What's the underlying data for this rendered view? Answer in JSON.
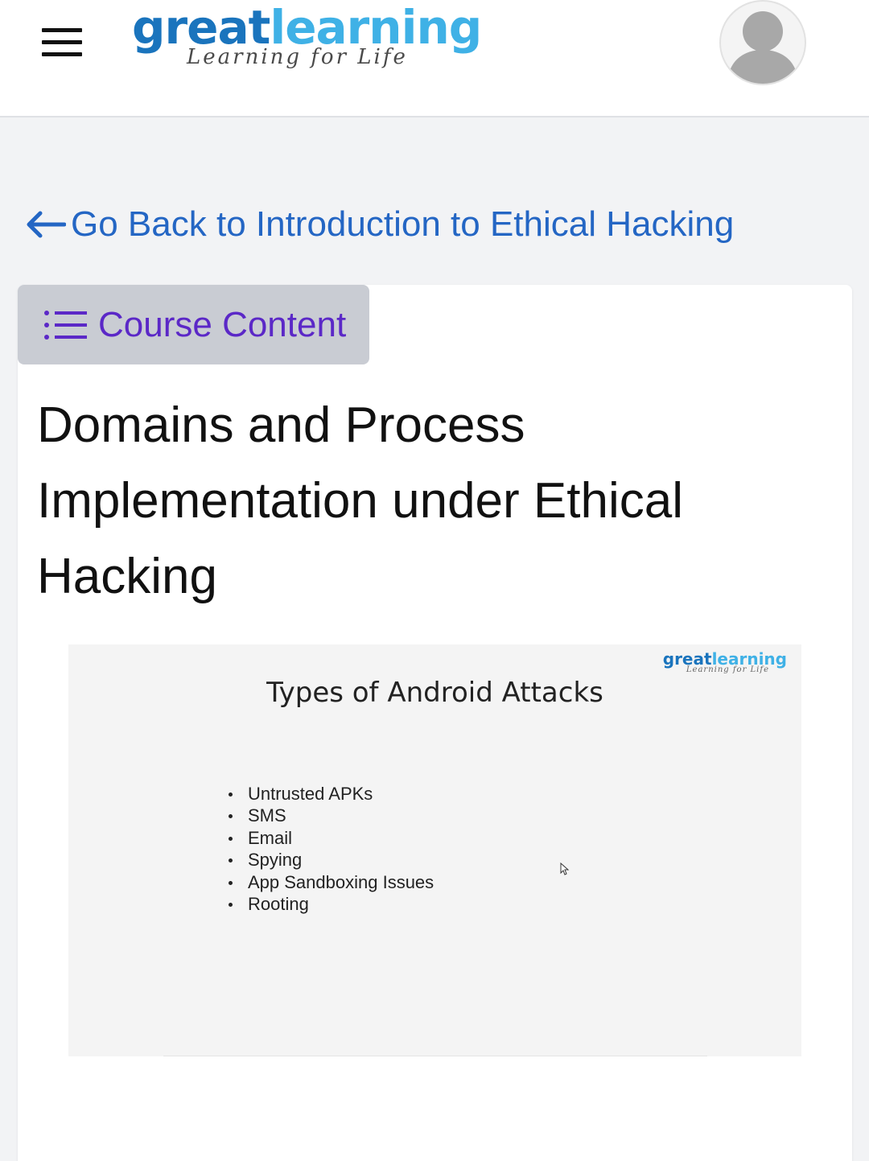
{
  "header": {
    "menu_icon": "hamburger-menu-icon",
    "logo": {
      "word_part1": "great",
      "word_part2": "learning",
      "tagline": "Learning for Life"
    },
    "avatar_icon": "user-avatar-icon"
  },
  "nav": {
    "back_icon": "arrow-left-icon",
    "back_label": "Go Back to Introduction to Ethical Hacking"
  },
  "course_content": {
    "icon": "list-icon",
    "label": "Course Content"
  },
  "lesson": {
    "title": "Domains and Process Implementation under Ethical Hacking"
  },
  "slide": {
    "logo": {
      "word_part1": "great",
      "word_part2": "learning",
      "tagline": "Learning for Life"
    },
    "title": "Types of Android Attacks",
    "items": [
      "Untrusted APKs",
      "SMS",
      "Email",
      "Spying",
      "App Sandboxing Issues",
      "Rooting"
    ]
  },
  "colors": {
    "link": "#2466c4",
    "course_content_text": "#5b28c7",
    "course_content_bg": "#c9ccd3",
    "logo_great": "#1a74bd",
    "logo_learning": "#3fb1e6"
  }
}
